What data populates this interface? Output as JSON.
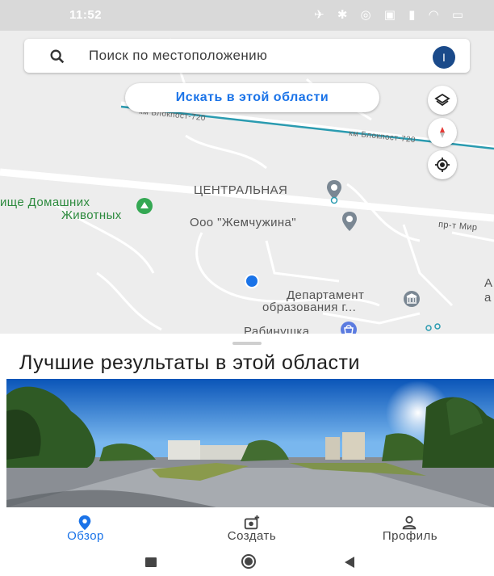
{
  "status_bar": {
    "time": "11:52"
  },
  "search": {
    "placeholder": "Поиск по местоположению",
    "avatar_letter": "I"
  },
  "map": {
    "search_area_button": "Искать в этой области",
    "road_labels": [
      "км Блокпост-720",
      "км Блокпост-720",
      "пр-т Мир"
    ],
    "places": [
      {
        "label": "ЦЕНТРАЛЬНАЯ",
        "kind": "pin"
      },
      {
        "label": "ище Домашних",
        "kind": "park"
      },
      {
        "label": "Животных",
        "kind": "park"
      },
      {
        "label": "Ооо \"Жемчужина\"",
        "kind": "pin"
      },
      {
        "label": "Департамент",
        "kind": "gov"
      },
      {
        "label": "образования г...",
        "kind": "gov"
      },
      {
        "label": "Рабинушка",
        "kind": "shop"
      },
      {
        "label": "А",
        "kind": "text"
      },
      {
        "label": "а",
        "kind": "text"
      }
    ],
    "accent": "#1a73e8"
  },
  "results": {
    "title": "Лучшие результаты в этой области"
  },
  "nav": {
    "items": [
      {
        "label": "Обзор",
        "icon": "location-pin-icon",
        "active": true
      },
      {
        "label": "Создать",
        "icon": "add-photo-icon",
        "active": false
      },
      {
        "label": "Профиль",
        "icon": "person-icon",
        "active": false
      }
    ]
  },
  "system_nav": {
    "icons": [
      "square-icon",
      "circle-icon",
      "back-triangle-icon"
    ]
  }
}
